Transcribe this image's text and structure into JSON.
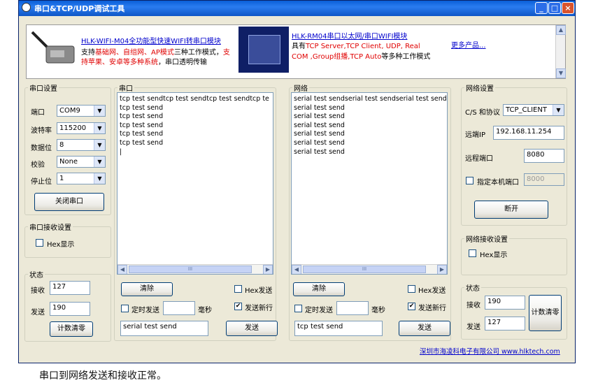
{
  "window": {
    "title": "串口&TCP/UDP调试工具"
  },
  "ad": {
    "product1_link": "HLK-WIFI-M04全功能型快速WIFI转串口模块",
    "product1_line1_a": "支持",
    "product1_line1_b": "基础网、自组网、AP模式",
    "product1_line1_c": "三种工作模式，",
    "product1_line1_d": "支",
    "product1_line2_a": "持苹果、安卓等多种系统",
    "product1_line2_b": "，串口透明传输",
    "product2_link": "HLK-RM04串口以太网/串口WIFI模块",
    "product2_line1_a": "具有",
    "product2_line1_b": "TCP Server,TCP Client, UDP, Real",
    "product2_line2_a": "COM ,Group组播,TCP Auto",
    "product2_line2_b": "等多种工作模式",
    "more_link": "更多产品..."
  },
  "serial_settings": {
    "legend": "串口设置",
    "port_label": "端口",
    "port_value": "COM9",
    "baud_label": "波特率",
    "baud_value": "115200",
    "databits_label": "数据位",
    "databits_value": "8",
    "parity_label": "校验",
    "parity_value": "None",
    "stopbits_label": "停止位",
    "stopbits_value": "1",
    "close_button": "关闭串口"
  },
  "serial_recv": {
    "legend": "串口接收设置",
    "hex_label": "Hex显示"
  },
  "serial_status": {
    "legend": "状态",
    "recv_label": "接收",
    "recv_value": "127",
    "send_label": "发送",
    "send_value": "190",
    "clear_button": "计数清零"
  },
  "serial_pane": {
    "legend": "串口",
    "lines": [
      "tcp test sendtcp test sendtcp test sendtcp te",
      "tcp test send",
      "tcp test send",
      "tcp test send",
      "tcp test send",
      "tcp test send"
    ],
    "clear_button": "清除",
    "hex_send_label": "Hex发送",
    "timer_label": "定时发送",
    "ms_label": "毫秒",
    "newline_label": "发送新行",
    "send_text": "serial test send",
    "send_button": "发送"
  },
  "net_pane": {
    "legend": "网络",
    "lines": [
      "serial test sendserial test sendserial test send",
      "serial test send",
      "serial test send",
      "serial test send",
      "serial test send",
      "serial test send",
      "serial test send"
    ],
    "clear_button": "清除",
    "hex_send_label": "Hex发送",
    "timer_label": "定时发送",
    "ms_label": "毫秒",
    "newline_label": "发送新行",
    "send_text": "tcp test send",
    "send_button": "发送"
  },
  "net_settings": {
    "legend": "网络设置",
    "proto_label": "C/S 和协议",
    "proto_value": "TCP_CLIENT",
    "ip_label": "远端IP",
    "ip_value": "192.168.11.254",
    "rport_label": "远程端口",
    "rport_value": "8080",
    "lport_label": "指定本机端口",
    "lport_value": "8000",
    "disconnect_button": "断开"
  },
  "net_recv": {
    "legend": "网络接收设置",
    "hex_label": "Hex显示"
  },
  "net_status": {
    "legend": "状态",
    "recv_label": "接收",
    "recv_value": "190",
    "send_label": "发送",
    "send_value": "127",
    "clear_button": "计数清零"
  },
  "footer": {
    "company": "深圳市海凌科电子有限公司 www.hlktech.com"
  },
  "caption": "串口到网络发送和接收正常。"
}
